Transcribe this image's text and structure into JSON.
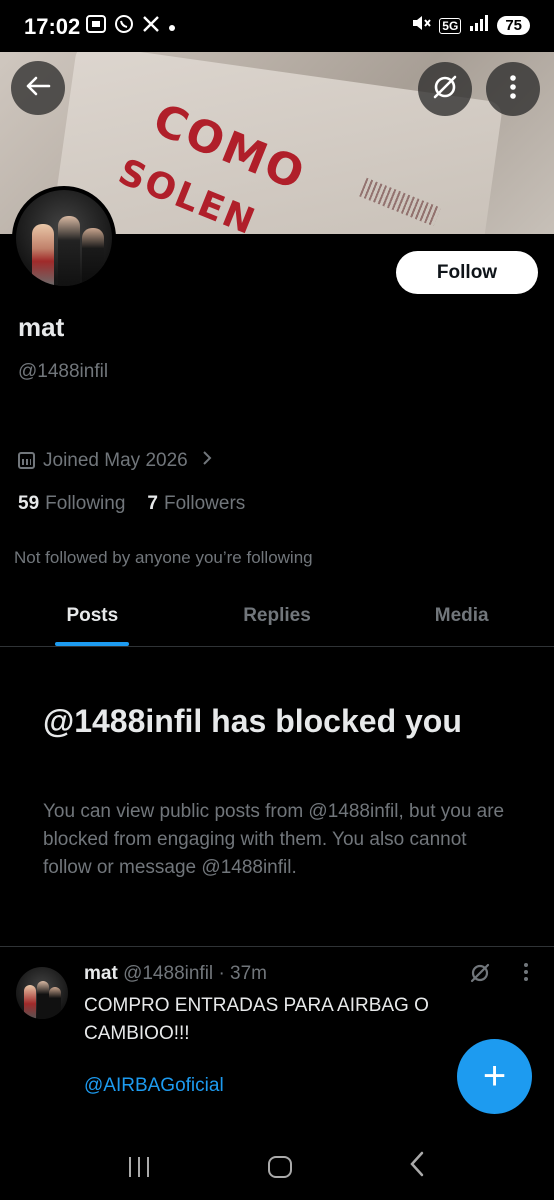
{
  "status_bar": {
    "time": "17:02",
    "left_icons": [
      "screenshot-icon",
      "whatsapp-icon",
      "x-icon",
      "dot-icon"
    ],
    "right_icons": [
      "mute-icon",
      "5g-icon",
      "signal-icon"
    ],
    "network": "5G",
    "battery": "75"
  },
  "header": {
    "back_icon": "arrow-left-icon",
    "grok_icon": "grok-icon",
    "more_icon": "more-vertical-icon"
  },
  "banner_text": [
    "COMO",
    "SOLEN"
  ],
  "profile": {
    "follow_label": "Follow",
    "name": "mat",
    "handle": "@1488infil",
    "joined": "Joined May 2026",
    "following_count": "59",
    "following_label": "Following",
    "followers_count": "7",
    "followers_label": "Followers",
    "not_followed": "Not followed by anyone you’re following"
  },
  "tabs": [
    {
      "label": "Posts",
      "active": true
    },
    {
      "label": "Replies",
      "active": false
    },
    {
      "label": "Media",
      "active": false
    }
  ],
  "blocked": {
    "title": "@1488infil has blocked you",
    "description": "You can view public posts from @1488infil, but you are blocked from engaging with them. You also cannot follow or message @1488infil."
  },
  "post": {
    "name": "mat",
    "handle": "@1488infil",
    "time": "· 37m",
    "text": "COMPRO ENTRADAS PARA AIRBAG O CAMBIOO!!!",
    "mention": "@AIRBAGoficial"
  },
  "fab": {
    "icon": "plus-icon",
    "label": "+"
  },
  "colors": {
    "accent": "#1d9bf0",
    "text": "#e7e9ea",
    "muted": "#71767b",
    "background": "#000000"
  }
}
